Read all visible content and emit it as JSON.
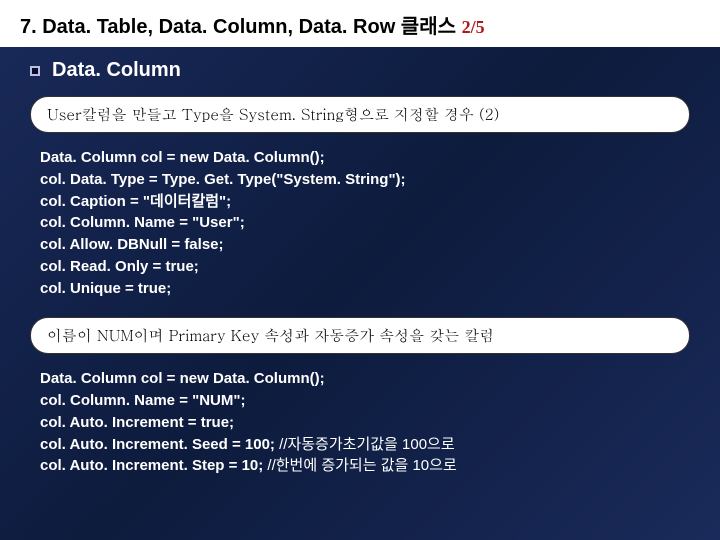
{
  "header": {
    "title_prefix": "7. Data. Table, Data. Column, Data. Row 클래스 ",
    "page": "2/5"
  },
  "subtitle": "Data. Column",
  "box1": {
    "text": "User칼럼을 만들고 Type을 System. String형으로 지정할 경우 (2)"
  },
  "code1": {
    "l1": "Data. Column col = new Data. Column();",
    "l2": "col. Data. Type = Type. Get. Type(\"System. String\");",
    "l3": "col. Caption = \"데이터칼럼\";",
    "l4": "col. Column. Name = \"User\";",
    "l5": "col. Allow. DBNull = false;",
    "l6": "col. Read. Only = true;",
    "l7": "col. Unique = true;"
  },
  "box2": {
    "text": "이름이 NUM이며 Primary Key 속성과 자동증가 속성을 갖는 칼럼"
  },
  "code2": {
    "l1": "Data. Column col = new Data. Column();",
    "l2": "col. Column. Name = \"NUM\";",
    "l3": "col. Auto. Increment = true;",
    "l4a": "col. Auto. Increment. Seed = 100; ",
    "l4b": "//자동증가초기값을 100으로",
    "l5a": "col. Auto. Increment. Step = 10;  ",
    "l5b": "//한번에 증가되는 값을 10으로"
  }
}
